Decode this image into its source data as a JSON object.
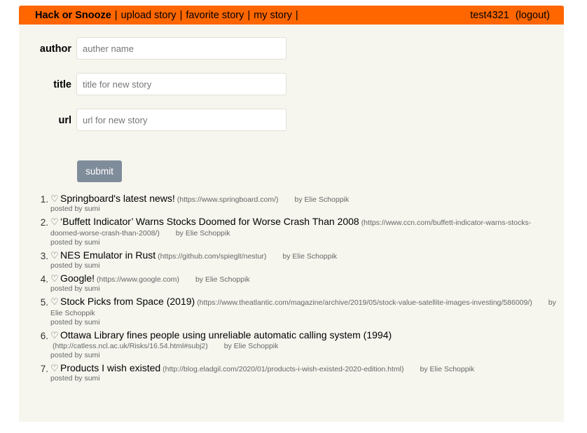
{
  "nav": {
    "brand": "Hack or Snooze",
    "links": [
      {
        "label": "upload story"
      },
      {
        "label": "favorite story"
      },
      {
        "label": "my story"
      }
    ],
    "separator": "|",
    "username": "test4321",
    "logout_label": "(logout)"
  },
  "form": {
    "author_label": "author",
    "author_placeholder": "auther name",
    "title_label": "title",
    "title_placeholder": "title for new story",
    "url_label": "url",
    "url_placeholder": "url for new story",
    "submit_label": "submit"
  },
  "stories": [
    {
      "num": "1.",
      "title": "Springboard's latest news!",
      "host": "(https://www.springboard.com/)",
      "author": "by Elie Schoppik",
      "posted_by": "posted by sumi"
    },
    {
      "num": "2.",
      "title": "‘Buffett Indicator’ Warns Stocks Doomed for Worse Crash Than 2008",
      "host": "(https://www.ccn.com/buffett-indicator-warns-stocks-doomed-worse-crash-than-2008/)",
      "author": "by Elie Schoppik",
      "posted_by": "posted by sumi"
    },
    {
      "num": "3.",
      "title": "NES Emulator in Rust",
      "host": "(https://github.com/spieglt/nestur)",
      "author": "by Elie Schoppik",
      "posted_by": "posted by sumi"
    },
    {
      "num": "4.",
      "title": "Google!",
      "host": "(https://www.google.com)",
      "author": "by Elie Schoppik",
      "posted_by": "posted by sumi"
    },
    {
      "num": "5.",
      "title": "Stock Picks from Space (2019)",
      "host": "(https://www.theatlantic.com/magazine/archive/2019/05/stock-value-satellite-images-investing/586009/)",
      "author": "by Elie Schoppik",
      "posted_by": "posted by sumi"
    },
    {
      "num": "6.",
      "title": "Ottawa Library fines people using unreliable automatic calling system (1994)",
      "host": "(http://catless.ncl.ac.uk/Risks/16.54.html#subj2)",
      "author": "by Elie Schoppik",
      "posted_by": "posted by sumi"
    },
    {
      "num": "7.",
      "title": "Products I wish existed",
      "host": "(http://blog.eladgil.com/2020/01/products-i-wish-existed-2020-edition.html)",
      "author": "by Elie Schoppik",
      "posted_by": "posted by sumi"
    }
  ],
  "icons": {
    "favorite": "heart-outline-icon"
  },
  "colors": {
    "nav_bg": "#ff6600",
    "page_bg": "#f6f6ef",
    "button_bg": "#7f8c9a"
  }
}
